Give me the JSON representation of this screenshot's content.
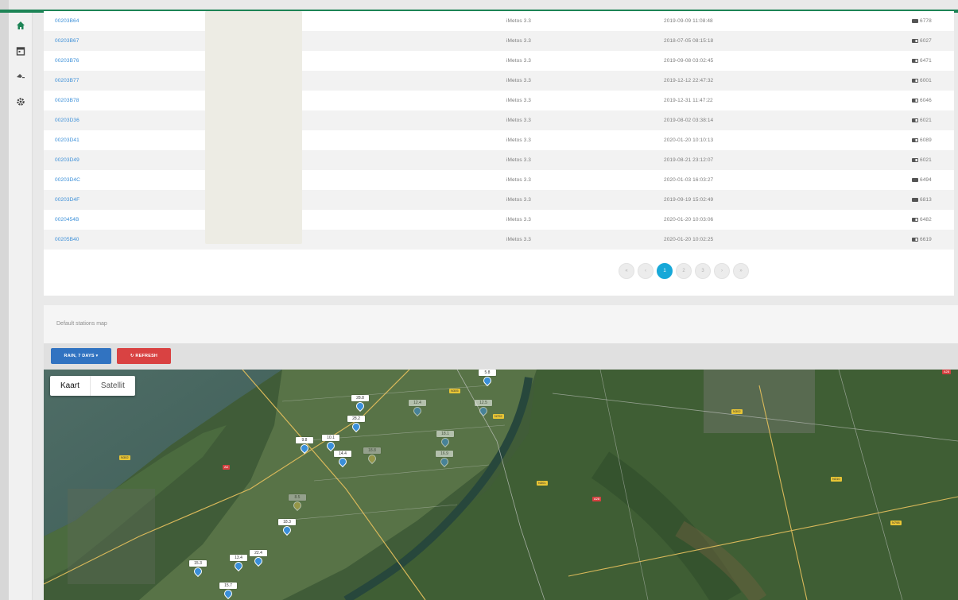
{
  "table": {
    "rows": [
      {
        "id": "00203B64",
        "type": "iMetos 3.3",
        "date": "2019-09-09 11:08:48",
        "battery": "6778",
        "bat_level": "full"
      },
      {
        "id": "00203B67",
        "type": "iMetos 3.3",
        "date": "2018-07-05 08:15:18",
        "battery": "6027",
        "bat_level": "half"
      },
      {
        "id": "00203B76",
        "type": "iMetos 3.3",
        "date": "2019-09-08 03:02:45",
        "battery": "6471",
        "bat_level": "half"
      },
      {
        "id": "00203B77",
        "type": "iMetos 3.3",
        "date": "2019-12-12 22:47:32",
        "battery": "6001",
        "bat_level": "half"
      },
      {
        "id": "00203B78",
        "type": "iMetos 3.3",
        "date": "2019-12-31 11:47:22",
        "battery": "6046",
        "bat_level": "half"
      },
      {
        "id": "00203D36",
        "type": "iMetos 3.3",
        "date": "2019-08-02 03:38:14",
        "battery": "6021",
        "bat_level": "half"
      },
      {
        "id": "00203D41",
        "type": "iMetos 3.3",
        "date": "2020-01-20 10:10:13",
        "battery": "6089",
        "bat_level": "half"
      },
      {
        "id": "00203D49",
        "type": "iMetos 3.3",
        "date": "2019-08-21 23:12:07",
        "battery": "6021",
        "bat_level": "half"
      },
      {
        "id": "00203D4C",
        "type": "iMetos 3.3",
        "date": "2020-01-03 16:03:27",
        "battery": "6494",
        "bat_level": "full"
      },
      {
        "id": "00203D4F",
        "type": "iMetos 3.3",
        "date": "2019-09-19 15:02:49",
        "battery": "6813",
        "bat_level": "full"
      },
      {
        "id": "0020454B",
        "type": "iMetos 3.3",
        "date": "2020-01-20 10:03:06",
        "battery": "6482",
        "bat_level": "half"
      },
      {
        "id": "00205B40",
        "type": "iMetos 3.3",
        "date": "2020-01-20 10:02:25",
        "battery": "6619",
        "bat_level": "half"
      }
    ]
  },
  "pagination": {
    "first": "«",
    "prev": "‹",
    "pages": [
      "1",
      "2",
      "3"
    ],
    "active": "1",
    "next": "›",
    "last": "»"
  },
  "map_panel": {
    "title": "Default stations map",
    "range_button": "RAIN, 7 DAYS ▾",
    "refresh_button": "↻ REFRESH",
    "map_type": {
      "map": "Kaart",
      "satellite": "Satellit"
    }
  },
  "map_markers": [
    {
      "label": "28.8",
      "style": "blue"
    },
    {
      "label": "28.2",
      "style": "blue"
    },
    {
      "label": "5.8",
      "style": "blue"
    },
    {
      "label": "12.4",
      "style": "blue"
    },
    {
      "label": "12.5",
      "style": "blue"
    },
    {
      "label": "9.8",
      "style": "blue"
    },
    {
      "label": "10.1",
      "style": "blue"
    },
    {
      "label": "14.4",
      "style": "blue"
    },
    {
      "label": "18.8",
      "style": "blue"
    },
    {
      "label": "18.1",
      "style": "blue"
    },
    {
      "label": "8.5",
      "style": "yellow"
    },
    {
      "label": "18.3",
      "style": "blue"
    },
    {
      "label": "13.4",
      "style": "blue"
    },
    {
      "label": "15.3",
      "style": "blue"
    },
    {
      "label": "22.4",
      "style": "blue"
    },
    {
      "label": "15.7",
      "style": "blue"
    },
    {
      "label": "16.9",
      "style": "blue"
    }
  ],
  "colors": {
    "accent": "#1d8456",
    "link": "#3b8fd8",
    "pager_active": "#17a8d8",
    "range_button": "#3173c1",
    "refresh_button": "#d94242"
  }
}
